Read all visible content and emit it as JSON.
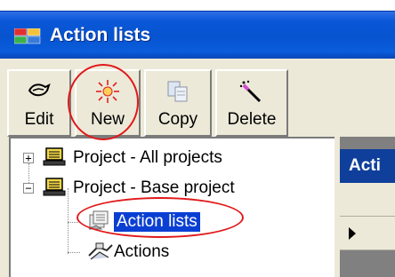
{
  "window": {
    "title": "Action lists",
    "icons": {
      "app": "app-window-icon"
    }
  },
  "toolbar": {
    "buttons": [
      {
        "id": "edit",
        "label": "Edit",
        "icon": "edit-icon"
      },
      {
        "id": "new",
        "label": "New",
        "icon": "new-icon"
      },
      {
        "id": "copy",
        "label": "Copy",
        "icon": "copy-icon"
      },
      {
        "id": "delete",
        "label": "Delete",
        "icon": "delete-icon"
      }
    ]
  },
  "tree": {
    "nodes": [
      {
        "label": "Project - All projects",
        "expander": "+",
        "icon": "project-icon"
      },
      {
        "label": "Project - Base project",
        "expander": "−",
        "icon": "project-icon"
      },
      {
        "label": "Action lists",
        "icon": "action-lists-icon",
        "selected": true
      },
      {
        "label": "Actions",
        "icon": "actions-icon"
      }
    ]
  },
  "grid": {
    "header": "Acti"
  },
  "colors": {
    "titlebar": "#0754d0",
    "selection": "#0a3fd3",
    "highlight_ellipse": "#e0191b",
    "grid_header": "#0f3f9a"
  }
}
